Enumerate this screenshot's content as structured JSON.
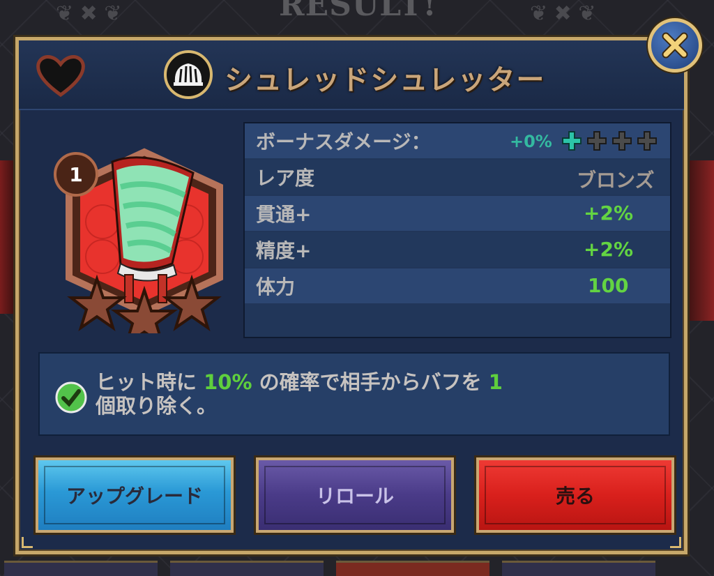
{
  "background": {
    "banner_text": "RESULT!"
  },
  "modal": {
    "title": "シュレッドシュレッター",
    "favorite_icon": "heart-icon",
    "item_type_icon": "fan-icon",
    "close_icon": "close-icon"
  },
  "item": {
    "level": "1",
    "stars": 3,
    "image": "fan-item-icon"
  },
  "stats": {
    "bonus_damage_label": "ボーナスダメージ：",
    "bonus_damage_value": "+0%",
    "bonus_upgrades_filled": 1,
    "bonus_upgrades_total": 4,
    "rows": [
      {
        "label": "レア度",
        "value": "ブロンズ"
      },
      {
        "label": "貫通+",
        "value": "+2%"
      },
      {
        "label": "精度+",
        "value": "+2%"
      },
      {
        "label": "体力",
        "value": "100"
      }
    ]
  },
  "ability": {
    "icon": "check-circle-icon",
    "part1": "ヒット時に",
    "chance": "10%",
    "part2": "の確率で相手からバフを",
    "count": "1",
    "line2": "個取り除く。"
  },
  "buttons": {
    "upgrade": "アップグレード",
    "reroll": "リロール",
    "sell": "売る"
  },
  "colors": {
    "panel": "#1c2b4a",
    "frame": "#c7a86a",
    "positive": "#63d442",
    "upgrade": "#2a99d6",
    "reroll": "#4a3b88",
    "sell": "#d9201c"
  }
}
